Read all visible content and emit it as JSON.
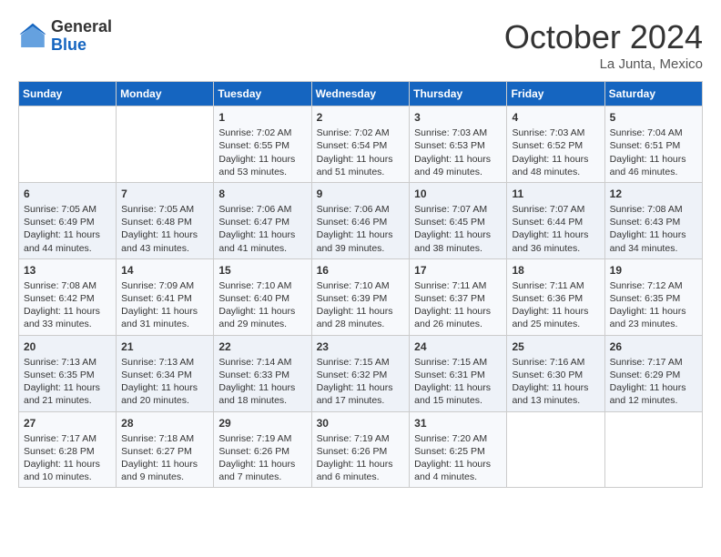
{
  "header": {
    "logo_general": "General",
    "logo_blue": "Blue",
    "month": "October 2024",
    "location": "La Junta, Mexico"
  },
  "days_of_week": [
    "Sunday",
    "Monday",
    "Tuesday",
    "Wednesday",
    "Thursday",
    "Friday",
    "Saturday"
  ],
  "weeks": [
    [
      {
        "day": "",
        "sunrise": "",
        "sunset": "",
        "daylight": ""
      },
      {
        "day": "",
        "sunrise": "",
        "sunset": "",
        "daylight": ""
      },
      {
        "day": "1",
        "sunrise": "Sunrise: 7:02 AM",
        "sunset": "Sunset: 6:55 PM",
        "daylight": "Daylight: 11 hours and 53 minutes."
      },
      {
        "day": "2",
        "sunrise": "Sunrise: 7:02 AM",
        "sunset": "Sunset: 6:54 PM",
        "daylight": "Daylight: 11 hours and 51 minutes."
      },
      {
        "day": "3",
        "sunrise": "Sunrise: 7:03 AM",
        "sunset": "Sunset: 6:53 PM",
        "daylight": "Daylight: 11 hours and 49 minutes."
      },
      {
        "day": "4",
        "sunrise": "Sunrise: 7:03 AM",
        "sunset": "Sunset: 6:52 PM",
        "daylight": "Daylight: 11 hours and 48 minutes."
      },
      {
        "day": "5",
        "sunrise": "Sunrise: 7:04 AM",
        "sunset": "Sunset: 6:51 PM",
        "daylight": "Daylight: 11 hours and 46 minutes."
      }
    ],
    [
      {
        "day": "6",
        "sunrise": "Sunrise: 7:05 AM",
        "sunset": "Sunset: 6:49 PM",
        "daylight": "Daylight: 11 hours and 44 minutes."
      },
      {
        "day": "7",
        "sunrise": "Sunrise: 7:05 AM",
        "sunset": "Sunset: 6:48 PM",
        "daylight": "Daylight: 11 hours and 43 minutes."
      },
      {
        "day": "8",
        "sunrise": "Sunrise: 7:06 AM",
        "sunset": "Sunset: 6:47 PM",
        "daylight": "Daylight: 11 hours and 41 minutes."
      },
      {
        "day": "9",
        "sunrise": "Sunrise: 7:06 AM",
        "sunset": "Sunset: 6:46 PM",
        "daylight": "Daylight: 11 hours and 39 minutes."
      },
      {
        "day": "10",
        "sunrise": "Sunrise: 7:07 AM",
        "sunset": "Sunset: 6:45 PM",
        "daylight": "Daylight: 11 hours and 38 minutes."
      },
      {
        "day": "11",
        "sunrise": "Sunrise: 7:07 AM",
        "sunset": "Sunset: 6:44 PM",
        "daylight": "Daylight: 11 hours and 36 minutes."
      },
      {
        "day": "12",
        "sunrise": "Sunrise: 7:08 AM",
        "sunset": "Sunset: 6:43 PM",
        "daylight": "Daylight: 11 hours and 34 minutes."
      }
    ],
    [
      {
        "day": "13",
        "sunrise": "Sunrise: 7:08 AM",
        "sunset": "Sunset: 6:42 PM",
        "daylight": "Daylight: 11 hours and 33 minutes."
      },
      {
        "day": "14",
        "sunrise": "Sunrise: 7:09 AM",
        "sunset": "Sunset: 6:41 PM",
        "daylight": "Daylight: 11 hours and 31 minutes."
      },
      {
        "day": "15",
        "sunrise": "Sunrise: 7:10 AM",
        "sunset": "Sunset: 6:40 PM",
        "daylight": "Daylight: 11 hours and 29 minutes."
      },
      {
        "day": "16",
        "sunrise": "Sunrise: 7:10 AM",
        "sunset": "Sunset: 6:39 PM",
        "daylight": "Daylight: 11 hours and 28 minutes."
      },
      {
        "day": "17",
        "sunrise": "Sunrise: 7:11 AM",
        "sunset": "Sunset: 6:37 PM",
        "daylight": "Daylight: 11 hours and 26 minutes."
      },
      {
        "day": "18",
        "sunrise": "Sunrise: 7:11 AM",
        "sunset": "Sunset: 6:36 PM",
        "daylight": "Daylight: 11 hours and 25 minutes."
      },
      {
        "day": "19",
        "sunrise": "Sunrise: 7:12 AM",
        "sunset": "Sunset: 6:35 PM",
        "daylight": "Daylight: 11 hours and 23 minutes."
      }
    ],
    [
      {
        "day": "20",
        "sunrise": "Sunrise: 7:13 AM",
        "sunset": "Sunset: 6:35 PM",
        "daylight": "Daylight: 11 hours and 21 minutes."
      },
      {
        "day": "21",
        "sunrise": "Sunrise: 7:13 AM",
        "sunset": "Sunset: 6:34 PM",
        "daylight": "Daylight: 11 hours and 20 minutes."
      },
      {
        "day": "22",
        "sunrise": "Sunrise: 7:14 AM",
        "sunset": "Sunset: 6:33 PM",
        "daylight": "Daylight: 11 hours and 18 minutes."
      },
      {
        "day": "23",
        "sunrise": "Sunrise: 7:15 AM",
        "sunset": "Sunset: 6:32 PM",
        "daylight": "Daylight: 11 hours and 17 minutes."
      },
      {
        "day": "24",
        "sunrise": "Sunrise: 7:15 AM",
        "sunset": "Sunset: 6:31 PM",
        "daylight": "Daylight: 11 hours and 15 minutes."
      },
      {
        "day": "25",
        "sunrise": "Sunrise: 7:16 AM",
        "sunset": "Sunset: 6:30 PM",
        "daylight": "Daylight: 11 hours and 13 minutes."
      },
      {
        "day": "26",
        "sunrise": "Sunrise: 7:17 AM",
        "sunset": "Sunset: 6:29 PM",
        "daylight": "Daylight: 11 hours and 12 minutes."
      }
    ],
    [
      {
        "day": "27",
        "sunrise": "Sunrise: 7:17 AM",
        "sunset": "Sunset: 6:28 PM",
        "daylight": "Daylight: 11 hours and 10 minutes."
      },
      {
        "day": "28",
        "sunrise": "Sunrise: 7:18 AM",
        "sunset": "Sunset: 6:27 PM",
        "daylight": "Daylight: 11 hours and 9 minutes."
      },
      {
        "day": "29",
        "sunrise": "Sunrise: 7:19 AM",
        "sunset": "Sunset: 6:26 PM",
        "daylight": "Daylight: 11 hours and 7 minutes."
      },
      {
        "day": "30",
        "sunrise": "Sunrise: 7:19 AM",
        "sunset": "Sunset: 6:26 PM",
        "daylight": "Daylight: 11 hours and 6 minutes."
      },
      {
        "day": "31",
        "sunrise": "Sunrise: 7:20 AM",
        "sunset": "Sunset: 6:25 PM",
        "daylight": "Daylight: 11 hours and 4 minutes."
      },
      {
        "day": "",
        "sunrise": "",
        "sunset": "",
        "daylight": ""
      },
      {
        "day": "",
        "sunrise": "",
        "sunset": "",
        "daylight": ""
      }
    ]
  ]
}
